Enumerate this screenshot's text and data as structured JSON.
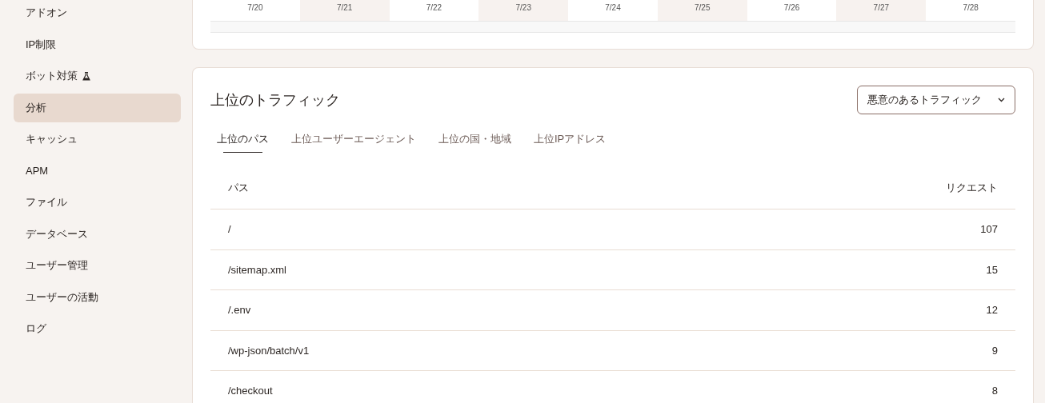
{
  "sidebar": {
    "items": [
      {
        "label": "アドオン",
        "selected": false,
        "experimental": false
      },
      {
        "label": "IP制限",
        "selected": false,
        "experimental": false
      },
      {
        "label": "ボット対策",
        "selected": false,
        "experimental": true
      },
      {
        "label": "分析",
        "selected": true,
        "experimental": false
      },
      {
        "label": "キャッシュ",
        "selected": false,
        "experimental": false
      },
      {
        "label": "APM",
        "selected": false,
        "experimental": false
      },
      {
        "label": "ファイル",
        "selected": false,
        "experimental": false
      },
      {
        "label": "データベース",
        "selected": false,
        "experimental": false
      },
      {
        "label": "ユーザー管理",
        "selected": false,
        "experimental": false
      },
      {
        "label": "ユーザーの活動",
        "selected": false,
        "experimental": false
      },
      {
        "label": "ログ",
        "selected": false,
        "experimental": false
      }
    ]
  },
  "chart_axis": {
    "dates": [
      "7/20",
      "7/21",
      "7/22",
      "7/23",
      "7/24",
      "7/25",
      "7/26",
      "7/27",
      "7/28"
    ]
  },
  "top_traffic": {
    "title": "上位のトラフィック",
    "filter": {
      "value": "悪意のあるトラフィック"
    },
    "tabs": [
      {
        "label": "上位のパス",
        "selected": true
      },
      {
        "label": "上位ユーザーエージェント",
        "selected": false
      },
      {
        "label": "上位の国・地域",
        "selected": false
      },
      {
        "label": "上位IPアドレス",
        "selected": false
      }
    ],
    "table": {
      "columns": [
        "パス",
        "リクエスト"
      ],
      "rows": [
        [
          "/",
          "107"
        ],
        [
          "/sitemap.xml",
          "15"
        ],
        [
          "/.env",
          "12"
        ],
        [
          "/wp-json/batch/v1",
          "9"
        ],
        [
          "/checkout",
          "8"
        ]
      ]
    }
  }
}
